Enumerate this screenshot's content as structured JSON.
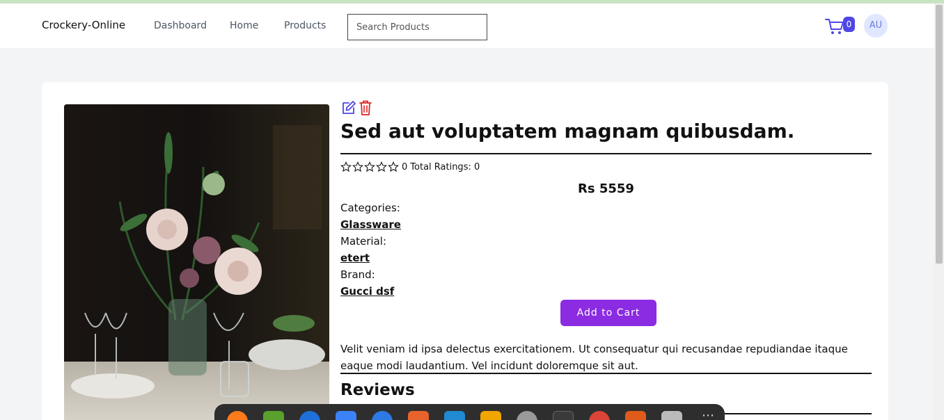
{
  "nav": {
    "brand": "Crockery-Online",
    "links": [
      "Dashboard",
      "Home",
      "Products"
    ],
    "search_placeholder": "Search Products",
    "cart_count": "0",
    "avatar": "AU"
  },
  "product": {
    "title": "Sed aut voluptatem magnam quibusdam.",
    "rating_value": "0",
    "total_ratings": "Total Ratings: 0",
    "stars": 0,
    "price": "Rs 5559",
    "categories_label": "Categories:",
    "category": "Glassware",
    "material_label": "Material:",
    "material": "etert",
    "brand_label": "Brand:",
    "brand": "Gucci dsf",
    "add_to_cart": "Add to Cart",
    "description": "Velit veniam id ipsa delectus exercitationem. Ut consequatur qui recusandae repudiandae itaque eaque modi laudantium. Vel incidunt doloremque sit aut."
  },
  "reviews_heading": "Reviews",
  "colors": {
    "accent": "#4f46e5",
    "button": "#8b2be2",
    "delete": "#dc2626"
  },
  "dock": {
    "icons": [
      "firefox-icon",
      "files-icon",
      "thunderbird-icon",
      "document-icon",
      "help-icon",
      "store-icon",
      "vscode-icon",
      "calculator-icon",
      "settings-icon",
      "terminal-icon",
      "chrome-icon",
      "editor-icon",
      "archive-icon",
      "apps-grid-icon"
    ]
  }
}
